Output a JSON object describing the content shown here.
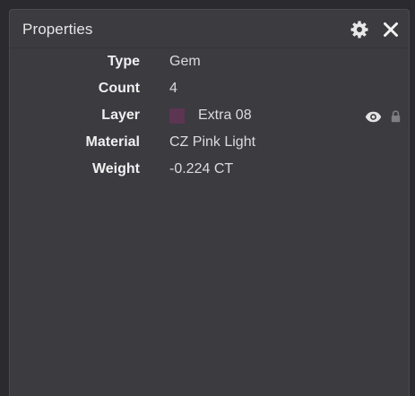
{
  "panel": {
    "title": "Properties",
    "header_icons": [
      "gear-icon",
      "close-icon"
    ]
  },
  "properties": [
    {
      "label": "Type",
      "value": "Gem"
    },
    {
      "label": "Count",
      "value": "4"
    },
    {
      "label": "Layer",
      "value": "Extra 08",
      "swatch_color": "#5c3552",
      "icons": [
        "eye-icon",
        "lock-icon"
      ]
    },
    {
      "label": "Material",
      "value": "CZ Pink Light"
    },
    {
      "label": "Weight",
      "value": "-0.224 CT"
    }
  ],
  "colors": {
    "background": "#2b2b2f",
    "panel": "#3b3b40",
    "label_text": "#f0f0f0",
    "value_text": "#dcdcdc",
    "layer_swatch": "#5c3552"
  }
}
